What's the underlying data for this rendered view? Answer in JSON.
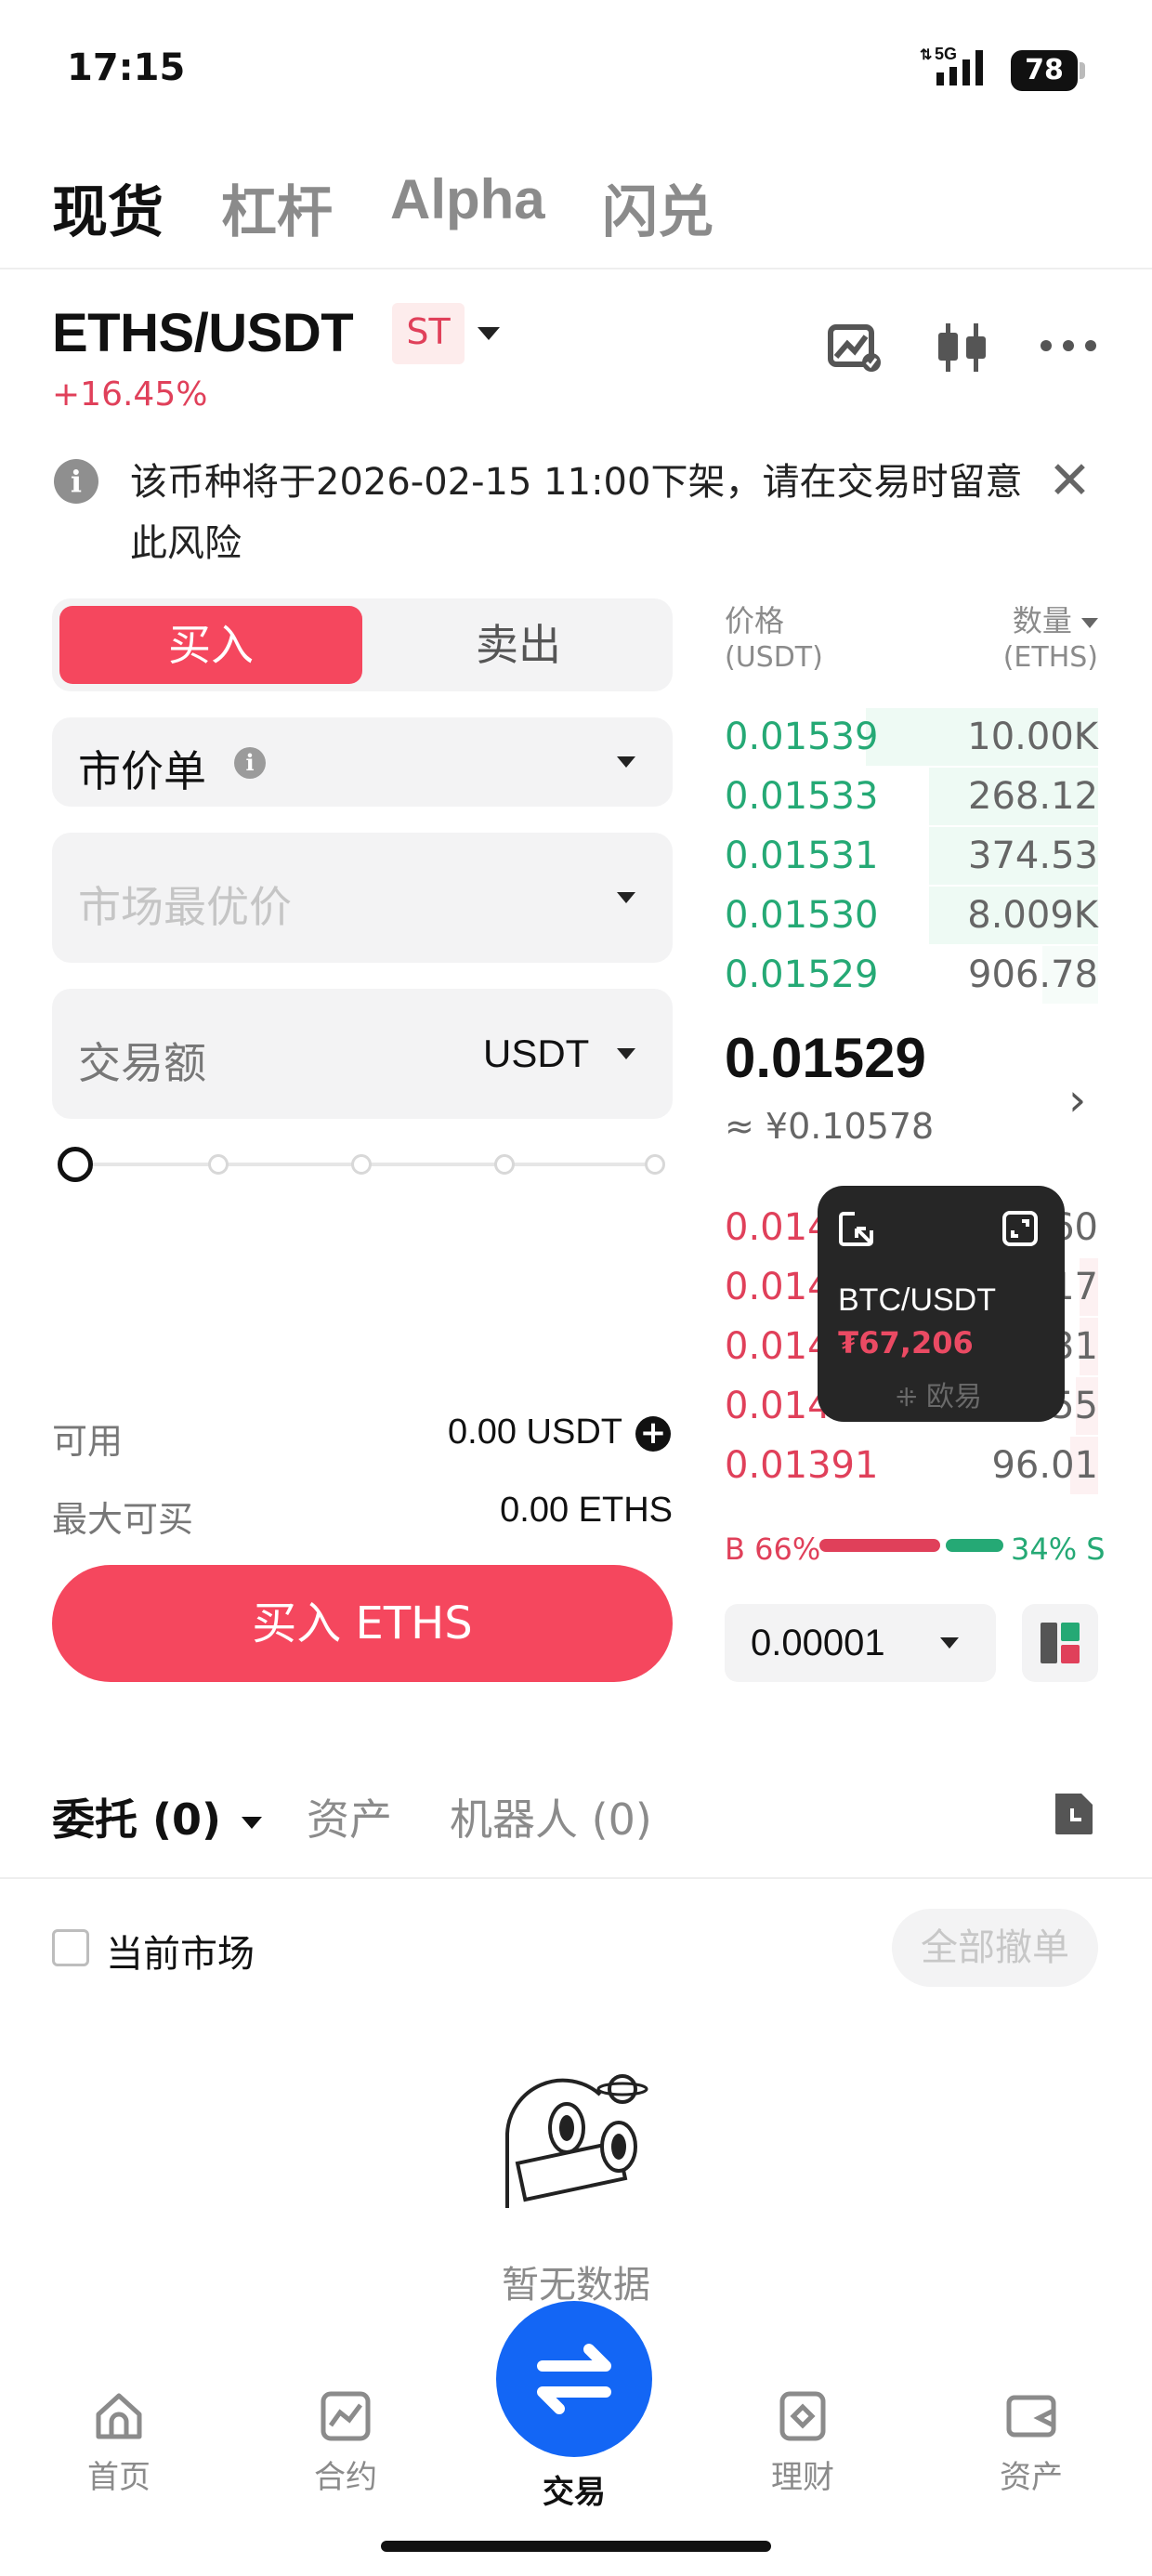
{
  "status_bar": {
    "time": "17:15",
    "network": "5G",
    "battery": "78"
  },
  "top_tabs": [
    "现货",
    "杠杆",
    "Alpha",
    "闪兑"
  ],
  "pair": {
    "name": "ETHS/USDT",
    "badge": "ST",
    "change": "+16.45%"
  },
  "notice": {
    "text": "该币种将于2026-02-15 11:00下架，请在交易时留意此风险"
  },
  "order_form": {
    "buy_label": "买入",
    "sell_label": "卖出",
    "order_type": "市价单",
    "price_placeholder": "市场最优价",
    "amount_label": "交易额",
    "amount_unit": "USDT",
    "slider_percent": 0,
    "available_label": "可用",
    "available_value": "0.00 USDT",
    "max_buy_label": "最大可买",
    "max_buy_value": "0.00 ETHS",
    "submit_label": "买入 ETHS"
  },
  "order_book": {
    "price_header": "价格",
    "price_unit": "(USDT)",
    "qty_header": "数量",
    "qty_unit": "(ETHS)",
    "asks": [
      {
        "price": "0.01539",
        "qty": "10.00K"
      },
      {
        "price": "0.01533",
        "qty": "268.12"
      },
      {
        "price": "0.01531",
        "qty": "374.53"
      },
      {
        "price": "0.01530",
        "qty": "8.009K"
      },
      {
        "price": "0.01529",
        "qty": "906.78"
      }
    ],
    "last_price": "0.01529",
    "last_price_cny": "≈ ¥0.10578",
    "bids": [
      {
        "price": "0.014",
        "qty": "60"
      },
      {
        "price": "0.014",
        "qty": "17"
      },
      {
        "price": "0.014",
        "qty": "31"
      },
      {
        "price": "0.014",
        "qty": "55"
      },
      {
        "price": "0.01391",
        "qty": "96.01"
      }
    ],
    "buy_ratio": "B 66%",
    "sell_ratio": "34% S",
    "buy_percent": 66,
    "precision": "0.00001"
  },
  "float_widget": {
    "pair": "BTC/USDT",
    "price": "₮67,206",
    "brand": "欧易"
  },
  "bottom_tabs": {
    "orders": "委托 (0)",
    "assets": "资产",
    "bots": "机器人 (0)"
  },
  "filters": {
    "current_market": "当前市场",
    "cancel_all": "全部撤单"
  },
  "empty_state": "暂无数据",
  "nav": [
    "首页",
    "合约",
    "交易",
    "理财",
    "资产"
  ],
  "colors": {
    "buy": "#f5475e",
    "ask_green": "#25a975",
    "bid_red": "#e0405a",
    "fab_blue": "#1366f5"
  }
}
